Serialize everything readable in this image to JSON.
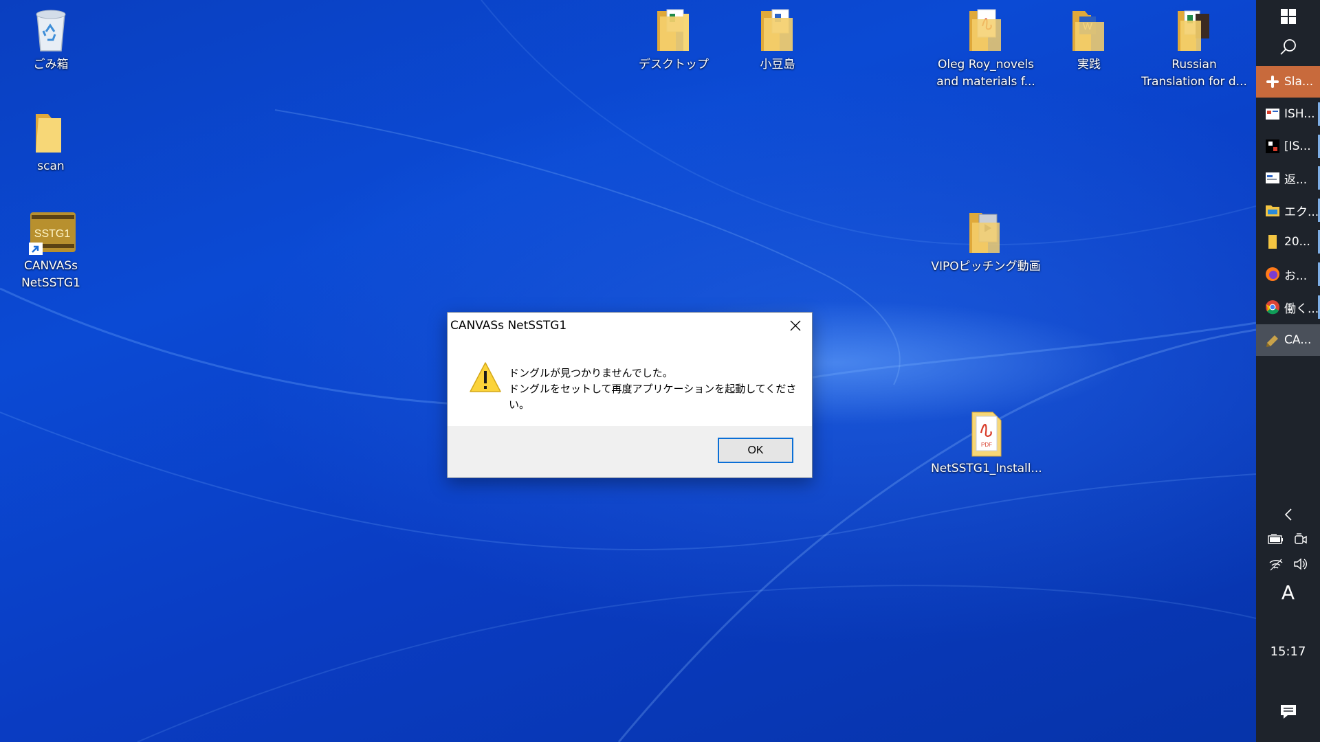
{
  "desktop": {
    "icons": [
      {
        "label": "ごみ箱",
        "icon": "recycle-bin-icon"
      },
      {
        "label": "scan",
        "icon": "folder-icon"
      },
      {
        "label": "CANVASs NetSSTG1",
        "icon": "canvass-app-shortcut-icon",
        "badge": "SSTG1"
      },
      {
        "label": "デスクトップ",
        "icon": "folder-excel-icon"
      },
      {
        "label": "小豆島",
        "icon": "folder-docs-icon"
      },
      {
        "label": "Oleg Roy_novels and materials f...",
        "icon": "folder-pdf-icon"
      },
      {
        "label": "実践",
        "icon": "folder-word-icon"
      },
      {
        "label": "Russian Translation for d...",
        "icon": "folder-photo-icon"
      },
      {
        "label": "VIPOピッチング動画",
        "icon": "folder-video-icon"
      },
      {
        "label": "NetSSTG1_Install...",
        "icon": "pdf-file-icon"
      }
    ]
  },
  "dialog": {
    "title": "CANVASs NetSSTG1",
    "message_line1": "ドングルが見つかりませんでした。",
    "message_line2": "ドングルをセットして再度アプリケーションを起動してください。",
    "ok_label": "OK",
    "icon": "warning-icon"
  },
  "taskbar": {
    "apps": [
      {
        "label": "Sla...",
        "icon": "slack-icon",
        "state": "active"
      },
      {
        "label": "ISH...",
        "icon": "window-app-icon",
        "state": "normal"
      },
      {
        "label": "[IS...",
        "icon": "game-app-icon",
        "state": "normal"
      },
      {
        "label": "返...",
        "icon": "mail-window-icon",
        "state": "normal"
      },
      {
        "label": "エク...",
        "icon": "file-explorer-icon",
        "state": "normal"
      },
      {
        "label": "20...",
        "icon": "folder-icon",
        "state": "normal"
      },
      {
        "label": "お...",
        "icon": "firefox-icon",
        "state": "normal"
      },
      {
        "label": "働く...",
        "icon": "chrome-icon",
        "state": "normal"
      },
      {
        "label": "CA...",
        "icon": "canvass-icon",
        "state": "focused"
      }
    ],
    "ime_indicator": "A",
    "clock": "15:17",
    "colors": {
      "taskbar": "#1e232b",
      "active_app": "#c86a3c",
      "focused_app": "#4a505a",
      "desktop_blue": "#0a3fc0"
    }
  }
}
